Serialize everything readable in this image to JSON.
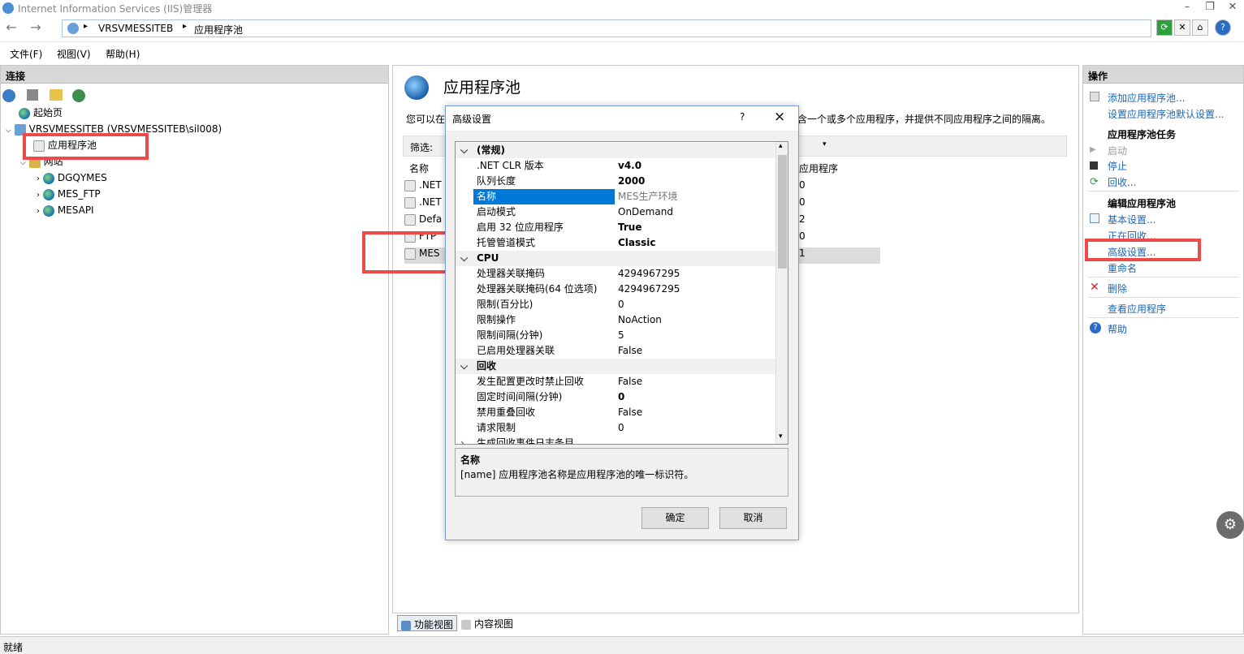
{
  "window": {
    "title": "Internet Information Services (IIS)管理器"
  },
  "address": {
    "segments": [
      "VRSVMESSITEB",
      "应用程序池"
    ]
  },
  "menu": [
    "文件(F)",
    "视图(V)",
    "帮助(H)"
  ],
  "left_panel": {
    "title": "连接",
    "tree": {
      "start_page": "起始页",
      "server": "VRSVMESSITEB (VRSVMESSITEB\\sil008)",
      "app_pools": "应用程序池",
      "sites": "网站",
      "site_items": [
        "DGQYMES",
        "MES_FTP",
        "MESAPI"
      ]
    }
  },
  "center_panel": {
    "title": "应用程序池",
    "desc_start": "您可以在",
    "desc_end": "含一个或多个应用程序，并提供不同应用程序之间的隔离。",
    "filter_label": "筛选:",
    "col_name": "名称",
    "col_apps": "应用程序",
    "rows": [
      {
        "name": ".NET",
        "apps": "0"
      },
      {
        "name": ".NET",
        "apps": "0"
      },
      {
        "name": "Defa",
        "apps": "2"
      },
      {
        "name": "FTP",
        "apps": "0"
      },
      {
        "name": "MES",
        "apps": "1"
      }
    ],
    "tab_features": "功能视图",
    "tab_content": "内容视图"
  },
  "dialog": {
    "title": "高级设置",
    "help": "?",
    "close": "×",
    "properties": [
      {
        "type": "cat",
        "key": "(常规)"
      },
      {
        "key": ".NET CLR 版本",
        "value": "v4.0",
        "bold": true
      },
      {
        "key": "队列长度",
        "value": "2000",
        "bold": true
      },
      {
        "key": "名称",
        "value": "MES生产环境",
        "selected": true
      },
      {
        "key": "启动模式",
        "value": "OnDemand"
      },
      {
        "key": "启用 32 位应用程序",
        "value": "True",
        "bold": true
      },
      {
        "key": "托管管道模式",
        "value": "Classic",
        "bold": true
      },
      {
        "type": "cat",
        "key": "CPU"
      },
      {
        "key": "处理器关联掩码",
        "value": "4294967295"
      },
      {
        "key": "处理器关联掩码(64 位选项)",
        "value": "4294967295"
      },
      {
        "key": "限制(百分比)",
        "value": "0"
      },
      {
        "key": "限制操作",
        "value": "NoAction"
      },
      {
        "key": "限制间隔(分钟)",
        "value": "5"
      },
      {
        "key": "已启用处理器关联",
        "value": "False"
      },
      {
        "type": "cat",
        "key": "回收"
      },
      {
        "key": "发生配置更改时禁止回收",
        "value": "False"
      },
      {
        "key": "固定时间间隔(分钟)",
        "value": "0",
        "bold": true
      },
      {
        "key": "禁用重叠回收",
        "value": "False"
      },
      {
        "key": "请求限制",
        "value": "0"
      },
      {
        "key": "生成回收事件日志条目",
        "value": ""
      }
    ],
    "desc_title": "名称",
    "desc_text": "[name] 应用程序池名称是应用程序池的唯一标识符。",
    "ok": "确定",
    "cancel": "取消"
  },
  "right_panel": {
    "title": "操作",
    "add_pool": "添加应用程序池...",
    "set_defaults": "设置应用程序池默认设置...",
    "tasks_header": "应用程序池任务",
    "start": "启动",
    "stop": "停止",
    "recycle": "回收...",
    "edit_header": "编辑应用程序池",
    "basic": "基本设置...",
    "recycling": "正在回收...",
    "advanced": "高级设置...",
    "rename": "重命名",
    "delete": "删除",
    "view_apps": "查看应用程序",
    "help": "帮助"
  },
  "status": {
    "text": "就绪"
  }
}
